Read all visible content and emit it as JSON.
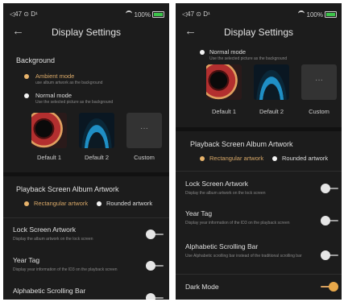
{
  "status": {
    "left": "◁47 ⊙ D¹",
    "battery": "100%"
  },
  "page_title": "Display Settings",
  "background": {
    "title": "Background",
    "ambient_label": "Ambient mode",
    "ambient_sub": "use album artwork as the background",
    "normal_label": "Normal mode",
    "normal_sub": "Use the selected picture as the background"
  },
  "pictures": [
    "Default 1",
    "Default 2",
    "Custom"
  ],
  "custom_glyph": "···",
  "album_artwork": {
    "title": "Playback Screen Album Artwork",
    "rect_label": "Rectangular artwork",
    "round_label": "Rounded artwork"
  },
  "settings": [
    {
      "title": "Lock Screen Artwork",
      "sub": "Display the album artwork on the lock screen",
      "on": false
    },
    {
      "title": "Year Tag",
      "sub": "Display year information of the ID3 on the playback screen",
      "on": false
    },
    {
      "title": "Alphabetic Scrolling Bar",
      "sub": "Use Alphabetic scrolling bar instead of the traditional scrolling bar",
      "on": false
    },
    {
      "title": "Dark Mode",
      "sub": "",
      "on": true
    }
  ],
  "colors": {
    "accent": "#e7b36b",
    "background": "#1c1c1c"
  }
}
